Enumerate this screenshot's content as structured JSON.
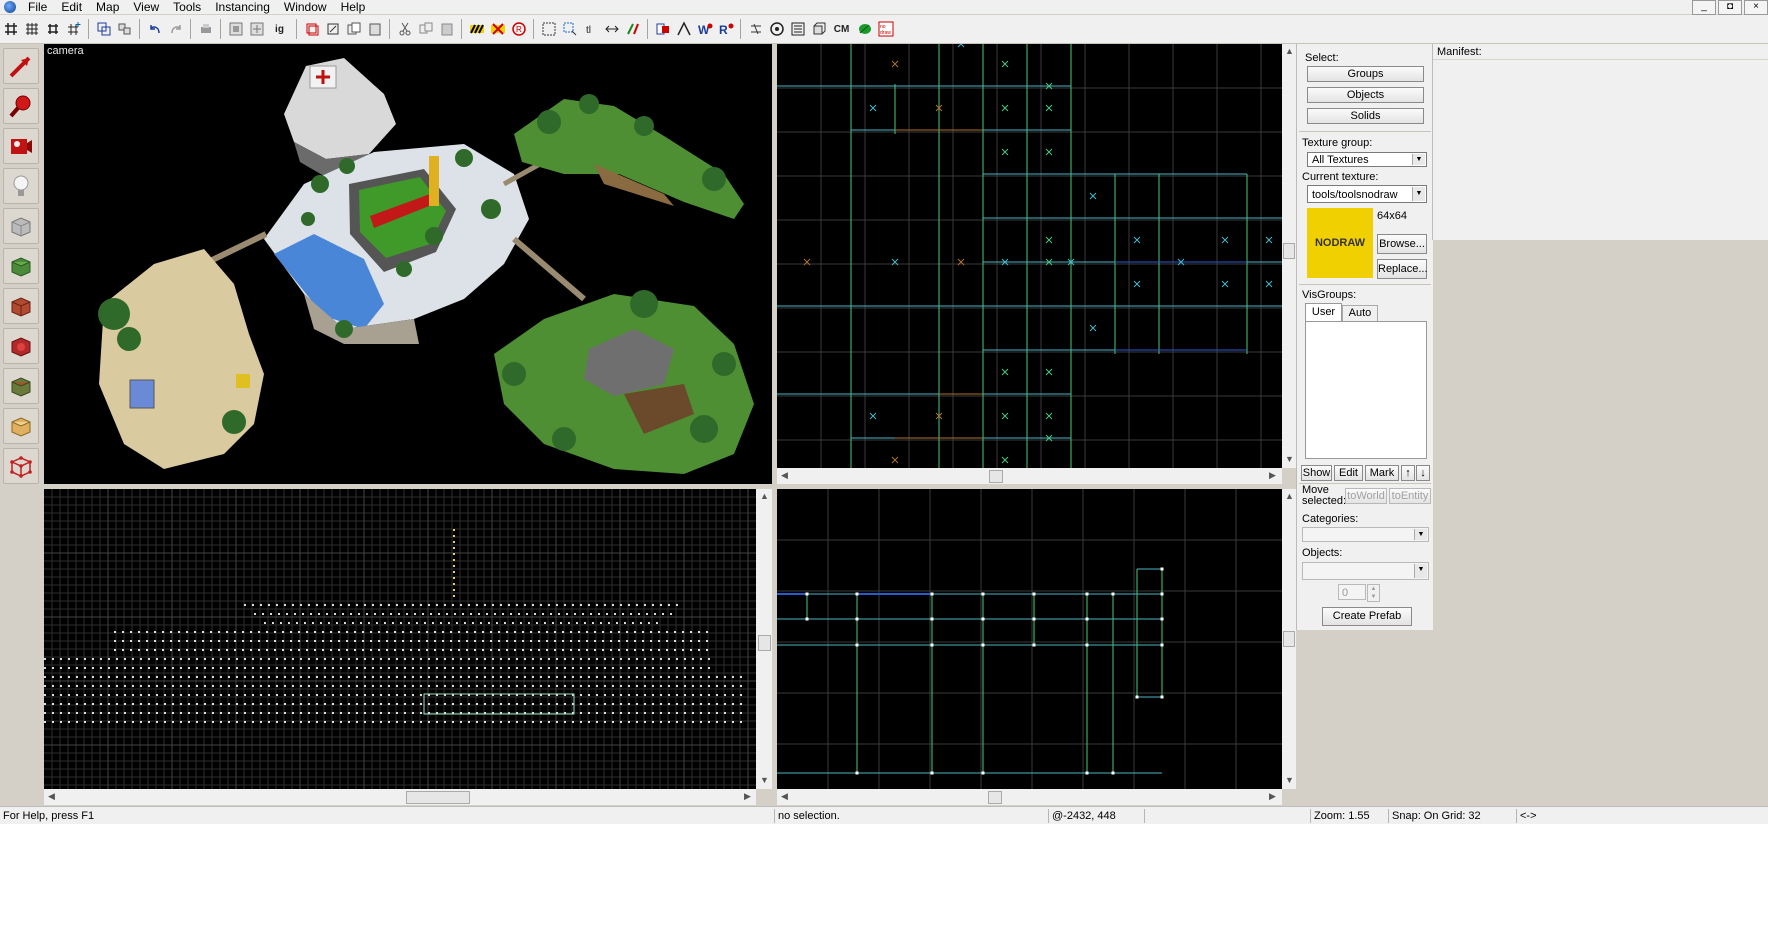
{
  "menu": {
    "items": [
      "File",
      "Edit",
      "Map",
      "View",
      "Tools",
      "Instancing",
      "Window",
      "Help"
    ]
  },
  "window_controls": [
    "_",
    "◘",
    "×"
  ],
  "toolbar": {
    "icons": [
      "grid-icon",
      "grid-toggle-icon",
      "grid-dots-icon",
      "grid-plus-icon",
      "carve-icon",
      "group-icon",
      "ungroup-icon",
      "undo-icon",
      "redo-icon",
      "print-icon",
      "hide-icon",
      "unhide-icon",
      "ignore-group-icon",
      "select-all-icon",
      "texture-lock-icon",
      "copy-icon",
      "paste-icon",
      "cut-icon",
      "hazard-icon",
      "hazard-x-icon",
      "record-icon",
      "box-select-icon",
      "box-select-alt-icon",
      "texture-tool-icon",
      "align-icon",
      "flip-icon",
      "entity-report-icon",
      "check-problems-icon",
      "wind-icon",
      "compile-icon",
      "quick-hide-icon",
      "camera-icon",
      "map-info-icon",
      "cubemap-icon",
      "leaf-icon",
      "nodraw-icon"
    ],
    "text_buttons": {
      "ig": "ig",
      "cm": "CM"
    }
  },
  "left_tools": [
    "selection-tool-icon",
    "magnify-tool-icon",
    "camera-tool-icon",
    "entity-tool-icon",
    "block-tool-icon",
    "texture-app-icon",
    "apply-current-texture-icon",
    "decal-tool-icon",
    "overlay-tool-icon",
    "clipping-tool-icon",
    "vertex-tool-icon"
  ],
  "viewports": {
    "camera": {
      "label": "camera"
    }
  },
  "panel": {
    "select_label": "Select:",
    "groups": "Groups",
    "objects": "Objects",
    "solids": "Solids",
    "texture_group_label": "Texture group:",
    "texture_group_value": "All Textures",
    "current_texture_label": "Current texture:",
    "current_texture_value": "tools/toolsnodraw",
    "texture_size": "64x64",
    "texture_preview_text": "NODRAW",
    "browse": "Browse...",
    "replace": "Replace...",
    "visgroups_label": "VisGroups:",
    "tab_user": "User",
    "tab_auto": "Auto",
    "show": "Show",
    "edit": "Edit",
    "mark": "Mark",
    "up": "↑",
    "down": "↓",
    "move_selected_label": "Move selected:",
    "to_world": "toWorld",
    "to_entity": "toEntity",
    "categories_label": "Categories:",
    "objects_label": "Objects:",
    "spin_value": "0",
    "create_prefab": "Create Prefab",
    "accent_yellow": "#f0d000"
  },
  "manifest": {
    "label": "Manifest:"
  },
  "status": {
    "help": "For Help, press F1",
    "selection": "no selection.",
    "coords": "@-2432, 448",
    "zoom": "Zoom: 1.55",
    "snap": "Snap: On Grid: 32",
    "arrows": "<->"
  }
}
